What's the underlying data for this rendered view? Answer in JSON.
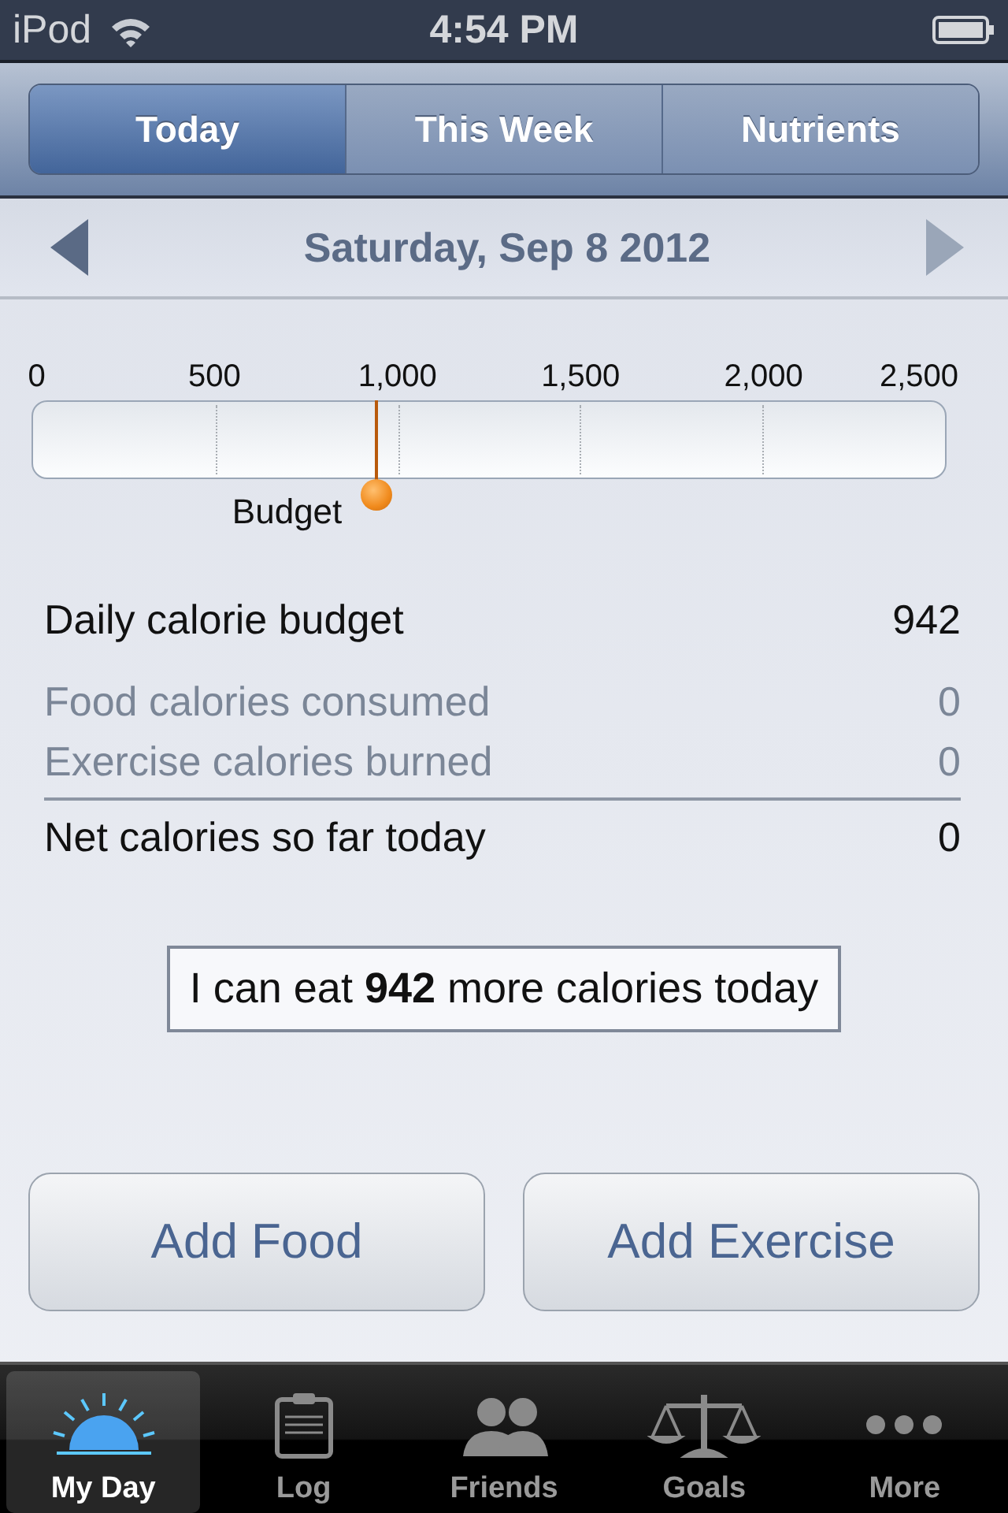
{
  "status_bar": {
    "device": "iPod",
    "time": "4:54 PM"
  },
  "tabs": [
    {
      "label": "Today",
      "selected": true
    },
    {
      "label": "This Week",
      "selected": false
    },
    {
      "label": "Nutrients",
      "selected": false
    }
  ],
  "date_nav": {
    "date": "Saturday, Sep 8 2012",
    "previous_disabled": false,
    "next_disabled": true
  },
  "scale": {
    "ticks": [
      "0",
      "500",
      "1,000",
      "1,500",
      "2,000",
      "2,500"
    ],
    "marker": {
      "label": "Budget"
    }
  },
  "summary": [
    {
      "kind": "budget",
      "label": "Daily calorie budget",
      "value": "942"
    },
    {
      "kind": "detail",
      "label": "Food calories consumed",
      "value": "0"
    },
    {
      "kind": "detail",
      "label": "Exercise calories burned",
      "value": "0"
    },
    {
      "kind": "total",
      "label": "Net calories so far today",
      "value": "0"
    }
  ],
  "message": "I can eat **942** more calories today",
  "buttons": [
    "Add Food",
    "Add Exercise"
  ],
  "tab_bar": [
    {
      "label": "My Day",
      "selected": true
    },
    {
      "label": "Log",
      "selected": false
    },
    {
      "label": "Friends",
      "selected": false
    },
    {
      "label": "Goals",
      "selected": false
    },
    {
      "label": "More",
      "selected": false
    }
  ]
}
